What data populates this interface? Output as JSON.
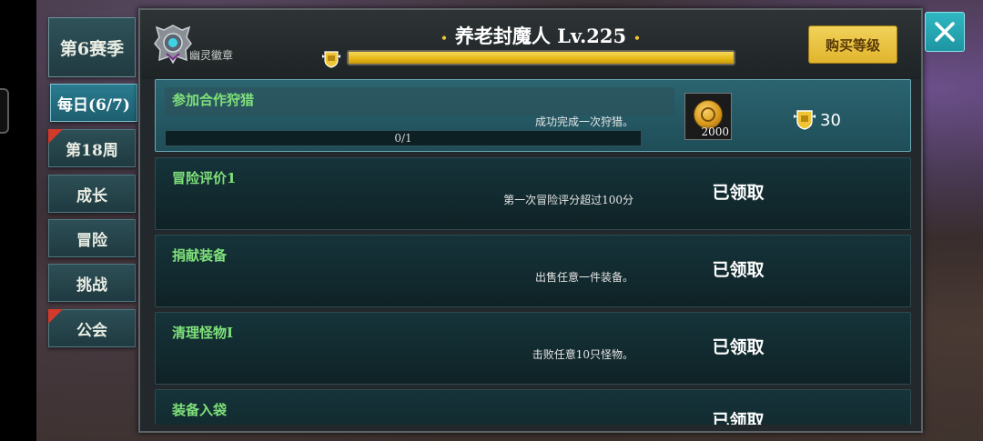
{
  "tabs": {
    "season": "第6赛季",
    "items": [
      {
        "label": "每日(6/7)",
        "active": true,
        "flag": false
      },
      {
        "label": "第18周",
        "active": false,
        "flag": true
      },
      {
        "label": "成长",
        "active": false,
        "flag": false
      },
      {
        "label": "冒险",
        "active": false,
        "flag": false
      },
      {
        "label": "挑战",
        "active": false,
        "flag": false
      },
      {
        "label": "公会",
        "active": false,
        "flag": true
      }
    ]
  },
  "header": {
    "emblem_label": "幽灵徽章",
    "title": "养老封魔人 Lv.225",
    "xp_progress": 1.0,
    "buy_label": "购买等级"
  },
  "tasks": [
    {
      "title": "参加合作狩猎",
      "desc": "成功完成一次狩猎。",
      "progress": "0/1",
      "reward_count": "2000",
      "xp": "30",
      "status": ""
    },
    {
      "title": "冒险评价1",
      "desc": "第一次冒险评分超过100分",
      "status": "已领取"
    },
    {
      "title": "捐献装备",
      "desc": "出售任意一件装备。",
      "status": "已领取"
    },
    {
      "title": "清理怪物Ⅰ",
      "desc": "击败任意10只怪物。",
      "status": "已领取"
    },
    {
      "title": "装备入袋",
      "desc": "",
      "status": "已领取"
    }
  ],
  "colors": {
    "accent": "#2fb7c2",
    "gold": "#e1b52d",
    "task_title": "#7fe07a"
  }
}
